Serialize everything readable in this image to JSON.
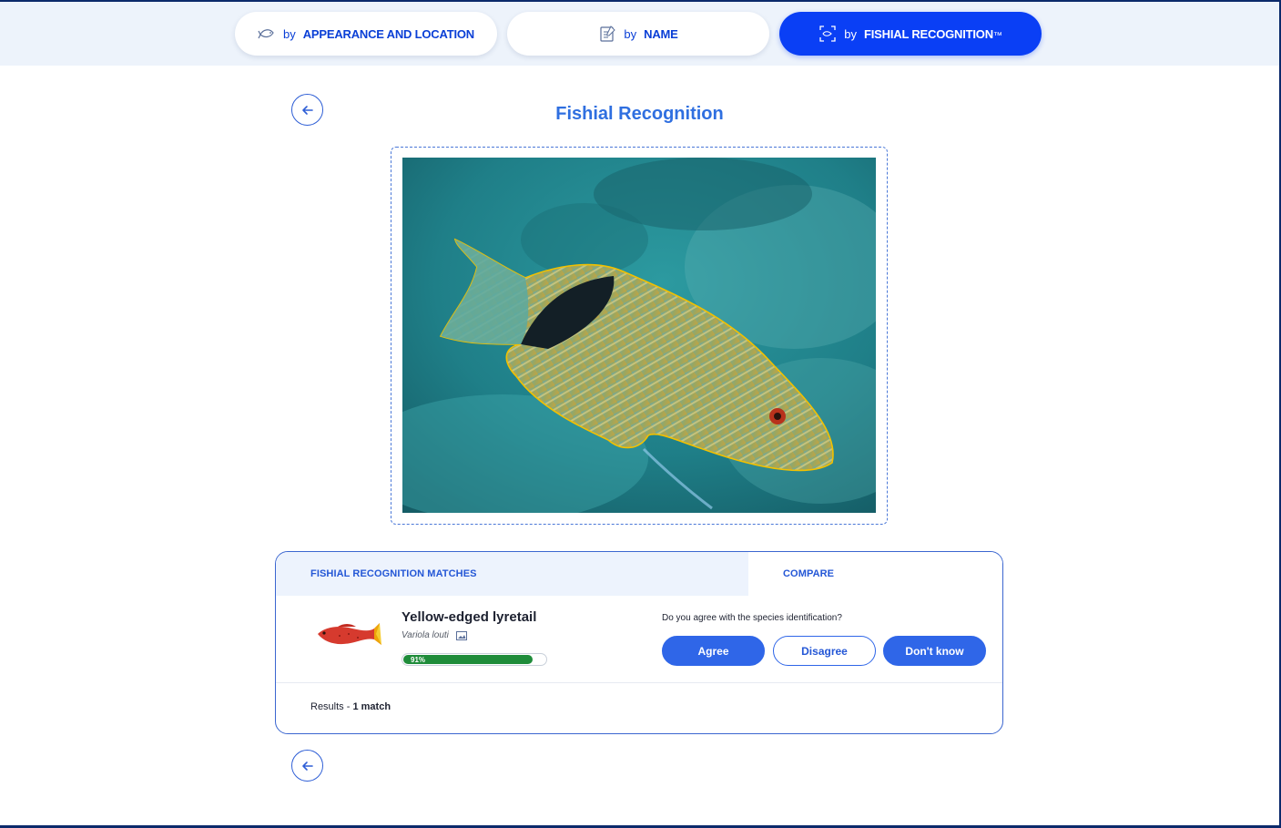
{
  "search_tabs": [
    {
      "by": "by",
      "name": "APPEARANCE AND LOCATION",
      "icon": "fish-outline-icon",
      "active": false
    },
    {
      "by": "by",
      "name": "NAME",
      "icon": "notepad-icon",
      "active": false
    },
    {
      "by": "by",
      "name": "FISHIAL RECOGNITION",
      "suffix": "™",
      "icon": "scan-frame-icon",
      "active": true
    }
  ],
  "page_title": "Fishial Recognition",
  "photo": {
    "alt": "Underwater photo of a fish outlined in yellow",
    "outline_color": "#f2c100"
  },
  "results": {
    "tabs": [
      {
        "label": "FISHIAL RECOGNITION MATCHES",
        "active": true
      },
      {
        "label": "COMPARE",
        "active": false
      }
    ],
    "matches": [
      {
        "common_name": "Yellow-edged lyretail",
        "scientific_name": "Variola louti",
        "confidence": 0.91,
        "confidence_label": "91%"
      }
    ],
    "question": "Do you agree with the species identification?",
    "buttons": {
      "agree": "Agree",
      "disagree": "Disagree",
      "dont_know": "Don't know"
    },
    "count_prefix": "Results - ",
    "count_value": "1 match"
  },
  "colors": {
    "accent": "#0a3ff5",
    "title": "#2f6fe0",
    "confidence_fill": "#1f8c3a",
    "band": "#edf3fb"
  }
}
